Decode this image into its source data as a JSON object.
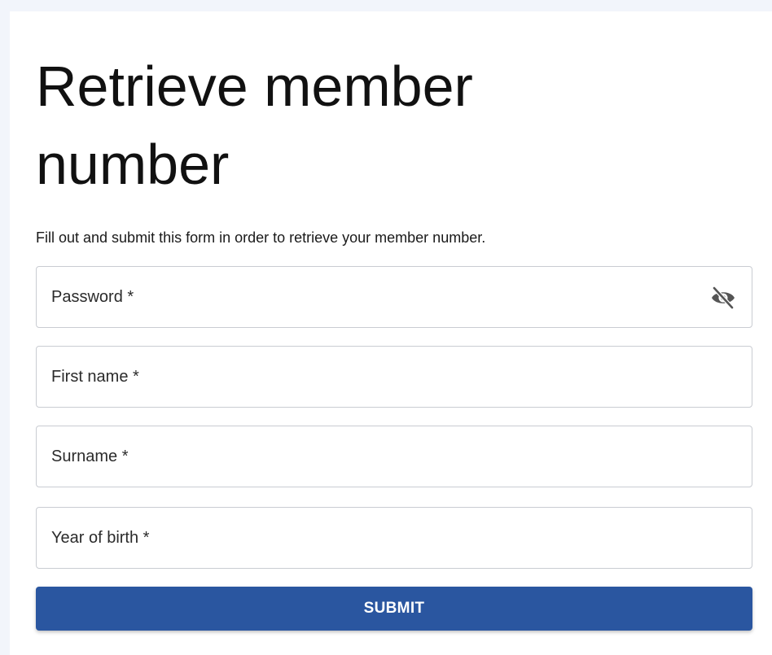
{
  "page": {
    "title": "Retrieve member number",
    "subtitle": "Fill out and submit this form in order to retrieve your member number."
  },
  "form": {
    "password": {
      "placeholder": "Password *",
      "value": "",
      "toggle_icon": "eye-off-icon"
    },
    "first_name": {
      "placeholder": "First name *",
      "value": ""
    },
    "surname": {
      "placeholder": "Surname *",
      "value": ""
    },
    "year_of_birth": {
      "placeholder": "Year of birth *",
      "value": ""
    },
    "submit_label": "SUBMIT"
  },
  "colors": {
    "primary": "#2a56a0",
    "page_background": "#f2f5fb",
    "field_border": "#c9ccd2",
    "icon": "#555555"
  }
}
